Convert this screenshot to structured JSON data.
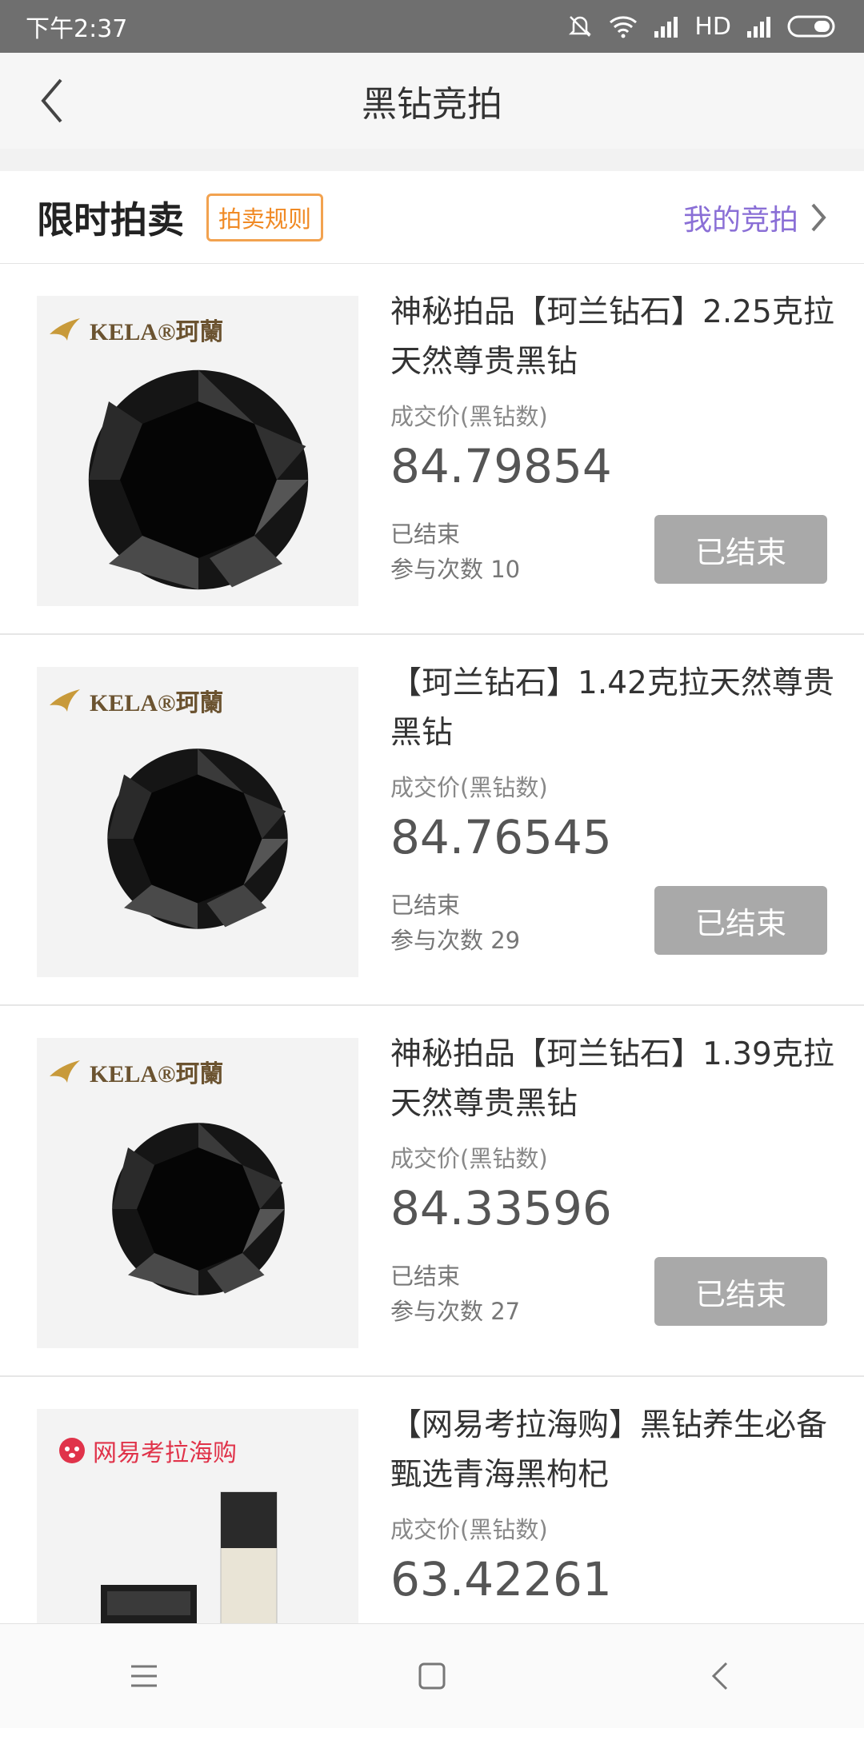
{
  "status_bar": {
    "time": "下午2:37",
    "network": "HD"
  },
  "header": {
    "title": "黑钻竞拍"
  },
  "section": {
    "title": "限时拍卖",
    "rules_label": "拍卖规则",
    "my_bids_label": "我的竞拍"
  },
  "items": [
    {
      "brand": "KELA®珂蘭",
      "title": "神秘拍品【珂兰钻石】2.25克拉天然尊贵黑钻",
      "price_label": "成交价(黑钻数)",
      "price": "84.79854",
      "status": "已结束",
      "participants": "参与次数 10",
      "button_label": "已结束"
    },
    {
      "brand": "KELA®珂蘭",
      "title": "【珂兰钻石】1.42克拉天然尊贵黑钻",
      "price_label": "成交价(黑钻数)",
      "price": "84.76545",
      "status": "已结束",
      "participants": "参与次数 29",
      "button_label": "已结束"
    },
    {
      "brand": "KELA®珂蘭",
      "title": "神秘拍品【珂兰钻石】1.39克拉天然尊贵黑钻",
      "price_label": "成交价(黑钻数)",
      "price": "84.33596",
      "status": "已结束",
      "participants": "参与次数 27",
      "button_label": "已结束"
    },
    {
      "brand": "网易考拉海购",
      "title": "【网易考拉海购】黑钻养生必备 甄选青海黑枸杞",
      "price_label": "成交价(黑钻数)",
      "price": "63.42261"
    }
  ],
  "colors": {
    "accent_orange": "#f08a25",
    "accent_purple": "#8a6fd6",
    "ended_button": "#a9a9a9",
    "kaola_red": "#e0334a"
  },
  "icons": [
    "silent-icon",
    "wifi-icon",
    "signal-icon",
    "battery-icon",
    "back-arrow-icon",
    "chevron-right-icon",
    "menu-icon",
    "home-icon",
    "back-icon"
  ]
}
